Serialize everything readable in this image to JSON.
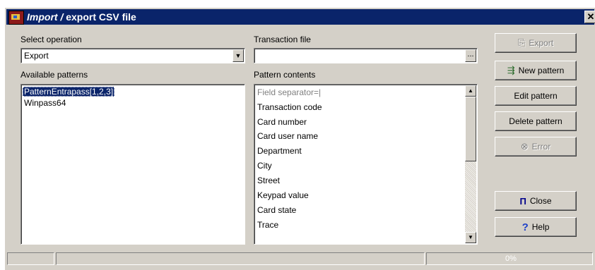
{
  "window": {
    "title_italic": "Import /",
    "title_rest": " export CSV file",
    "close_glyph": "✕"
  },
  "select_operation": {
    "label": "Select operation",
    "value": "Export"
  },
  "transaction_file": {
    "label": "Transaction file",
    "value": "",
    "browse_label": "..."
  },
  "available_patterns": {
    "label": "Available patterns",
    "items": [
      "PatternEntrapass[1,2,3]",
      "Winpass64"
    ],
    "selected": "PatternEntrapass[1,2,3]"
  },
  "pattern_contents": {
    "label": "Pattern contents",
    "items": [
      "Field separator=|",
      "Transaction code",
      "Card number",
      "Card user name",
      "Department",
      "City",
      "Street",
      "Keypad value",
      "Card state",
      "Trace"
    ]
  },
  "buttons": {
    "export": "Export",
    "new_pattern": "New pattern",
    "edit_pattern": "Edit pattern",
    "delete_pattern": "Delete pattern",
    "error": "Error",
    "close": "Close",
    "help": "Help"
  },
  "status": {
    "progress_text": "0%"
  },
  "icons": {
    "app": "import-export-app-icon",
    "export": "export-icon",
    "new_pattern": "new-pattern-icon",
    "error": "error-circle-icon",
    "close": "exit-door-icon",
    "help": "question-mark-icon"
  },
  "colors": {
    "title_bar": "#0a246a",
    "face": "#d4d0c8",
    "selection": "#0a246a",
    "help_icon": "#1e40c8",
    "close_icon": "#00008b"
  }
}
